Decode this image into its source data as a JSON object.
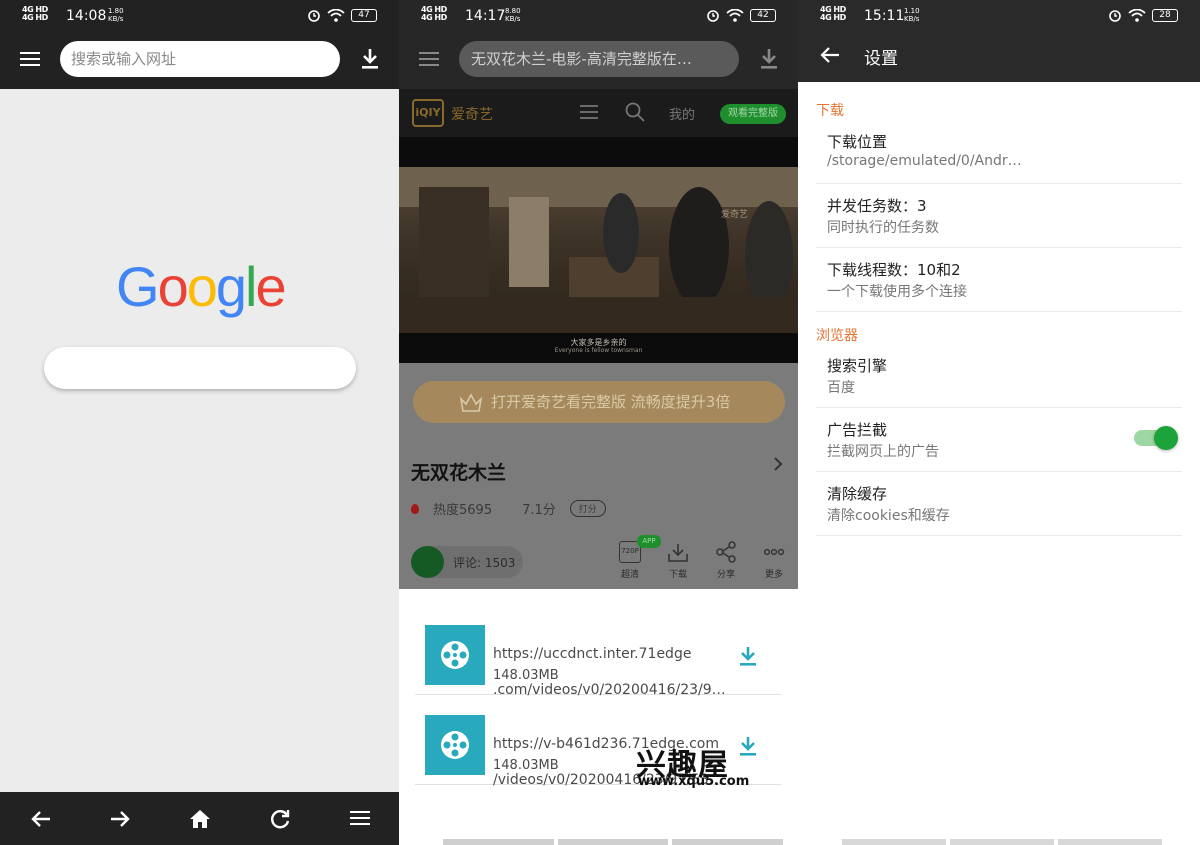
{
  "panel1": {
    "status": {
      "net": "4G HD 4G HD",
      "time": "14:08",
      "speed": "1.80\nKB/s",
      "battery": "47"
    },
    "url_placeholder": "搜索或输入网址",
    "google": {
      "letters": [
        "G",
        "o",
        "o",
        "g",
        "l",
        "e"
      ],
      "colors": [
        "#4285f4",
        "#ea4335",
        "#fbbc05",
        "#4285f4",
        "#34a853",
        "#ea4335"
      ]
    }
  },
  "panel2": {
    "status": {
      "net": "4G HD 4G HD",
      "time": "14:17",
      "speed": "8.80\nKB/s",
      "battery": "42"
    },
    "url_text": "无双花木兰-电影-高清完整版在…",
    "site": {
      "logo": "iQIY",
      "name": "爱奇艺",
      "mine": "我的",
      "vip": "观看完整版"
    },
    "video": {
      "sub_cn": "大家多是乡亲的",
      "sub_en": "Everyone is fellow townsman",
      "watermark": "爱奇艺"
    },
    "promo": "打开爱奇艺看完整版 流畅度提升3倍",
    "movie_title": "无双花木兰",
    "heat": "热度5695",
    "score": "7.1分",
    "rate_tag": "打分",
    "comments": "评论: 1503",
    "actions": [
      {
        "label": "超清",
        "badge": "720P"
      },
      {
        "label": "下载"
      },
      {
        "label": "分享"
      },
      {
        "label": "更多"
      }
    ],
    "app_badge": "APP",
    "downloads": [
      {
        "url_line1": "https://uccdnct.inter.71edge",
        "url_line2": ".com/videos/v0/20200416/23/9…",
        "size": "148.03MB"
      },
      {
        "url_line1": "https://v-b461d236.71edge.com",
        "url_line2": "/videos/v0/20200416/23/97/53f…",
        "size": "148.03MB"
      }
    ],
    "watermark": {
      "logo": "兴趣屋",
      "url": "www.xqu5.com"
    }
  },
  "panel3": {
    "status": {
      "net": "4G HD 4G HD",
      "time": "15:11",
      "speed": "1.10\nKB/s",
      "battery": "28"
    },
    "title": "设置",
    "sections": [
      {
        "header": "下载",
        "items": [
          {
            "title": "下载位置",
            "subtitle": "/storage/emulated/0/Andr…"
          },
          {
            "title": "并发任务数：3",
            "subtitle": "同时执行的任务数"
          },
          {
            "title": "下载线程数：10和2",
            "subtitle": "一个下载使用多个连接"
          }
        ]
      },
      {
        "header": "浏览器",
        "items": [
          {
            "title": "搜索引擎",
            "subtitle": "百度"
          },
          {
            "title": "广告拦截",
            "subtitle": "拦截网页上的广告",
            "toggle": true
          },
          {
            "title": "清除缓存",
            "subtitle": "清除cookies和缓存"
          }
        ]
      }
    ],
    "colors": {
      "section": "#e37432",
      "toggle": "#1ca33a"
    }
  }
}
